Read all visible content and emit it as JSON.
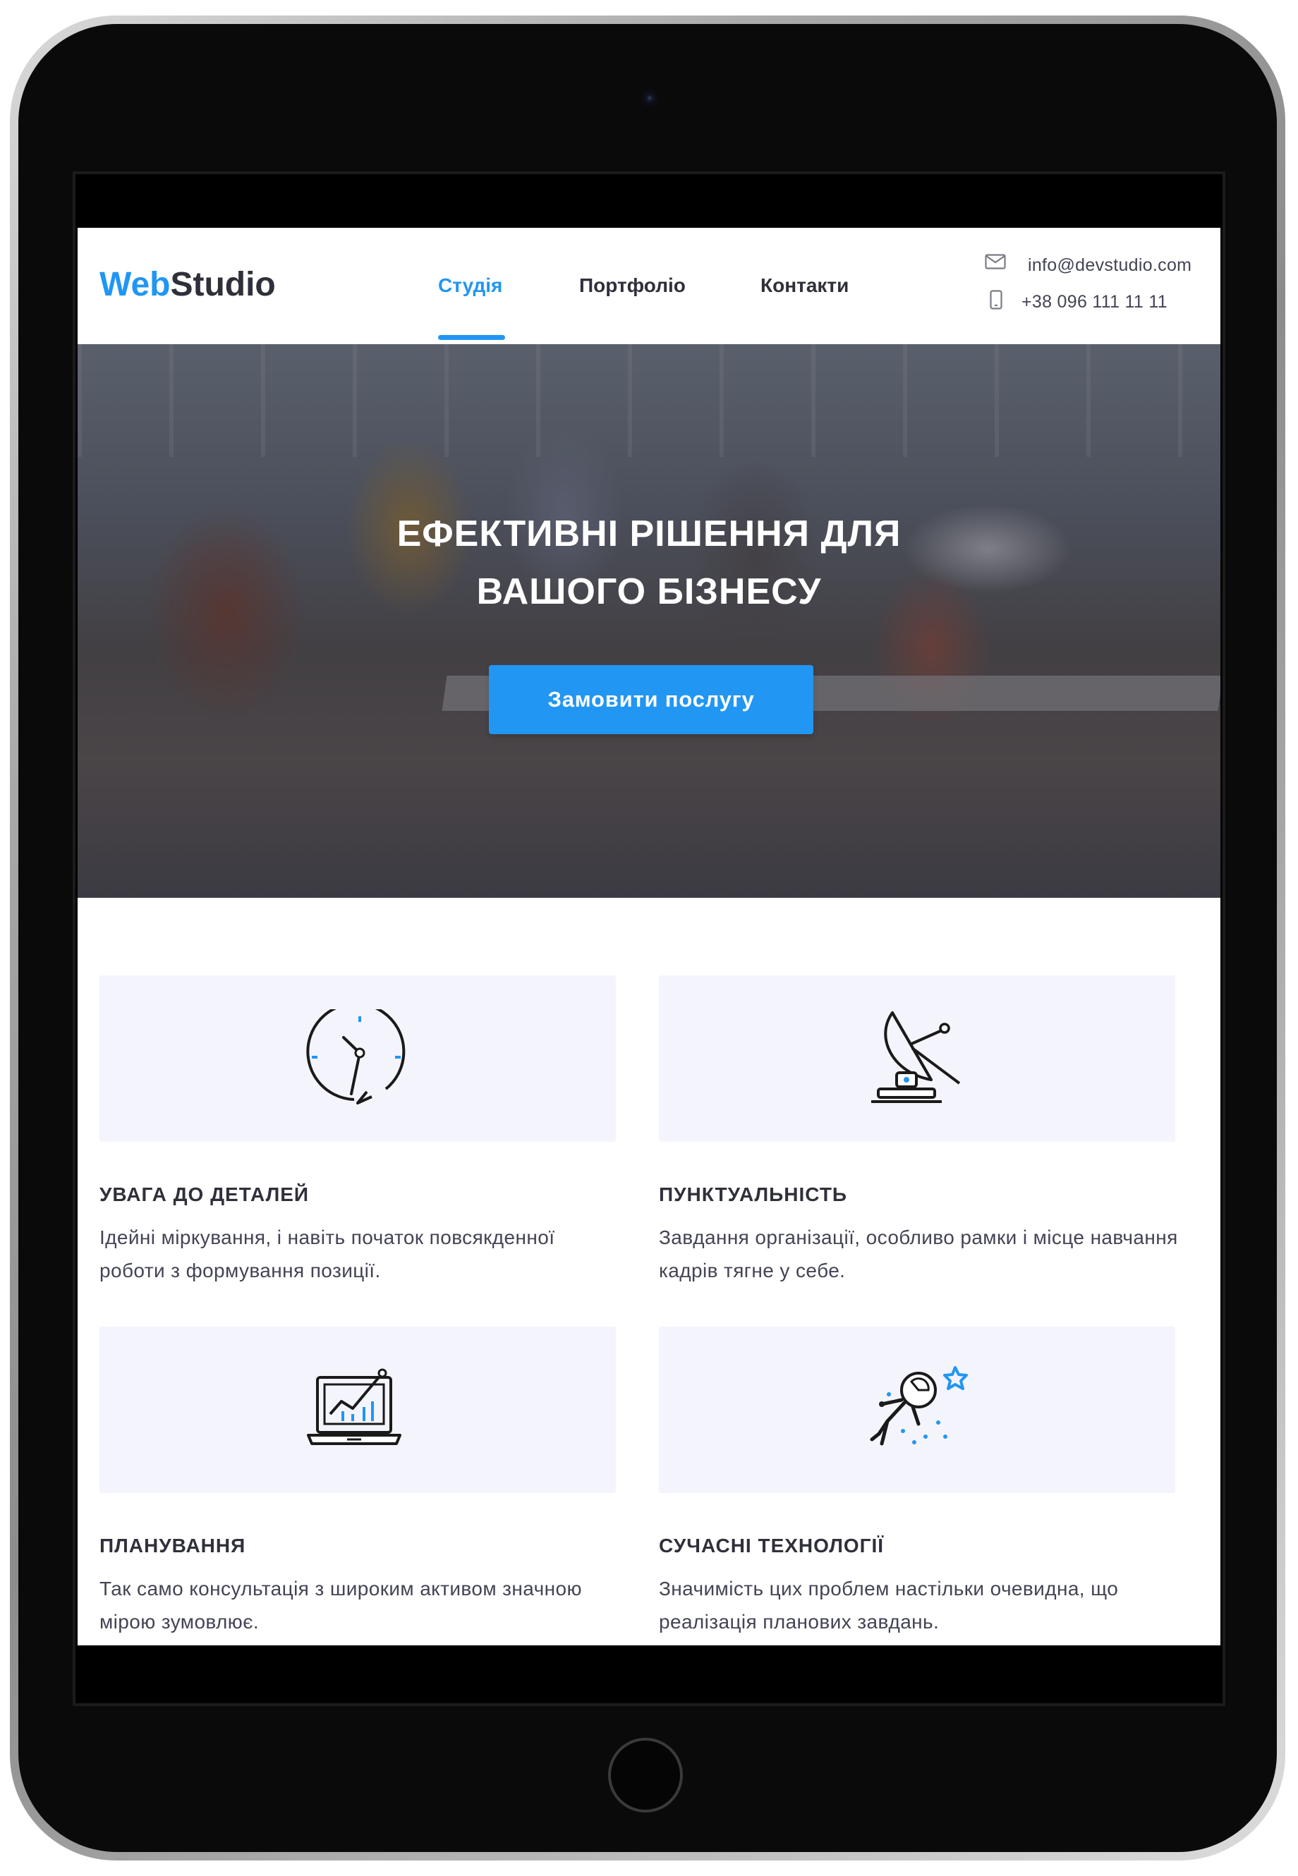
{
  "site": {
    "logo": {
      "part1": "Web",
      "part2": "Studio"
    },
    "nav": [
      {
        "label": "Студія",
        "active": true
      },
      {
        "label": "Портфоліо",
        "active": false
      },
      {
        "label": "Контакти",
        "active": false
      }
    ],
    "contacts": {
      "email": "info@devstudio.com",
      "phone": "+38 096 111 11 11",
      "email_icon": "mail-icon",
      "phone_icon": "smartphone-icon"
    },
    "hero": {
      "title_line1": "Ефективні рішення для",
      "title_line2": "вашого бізнесу",
      "button": "Замовити послугу"
    },
    "features": [
      {
        "icon": "clock-icon",
        "title": "Увага до деталей",
        "text": "Ідейні міркування, і навіть початок повсякденної роботи з формування позиції."
      },
      {
        "icon": "satellite-dish-icon",
        "title": "Пунктуальність",
        "text": "Завдання організації, особливо рамки і місце навчання кадрів тягне у себе."
      },
      {
        "icon": "laptop-chart-icon",
        "title": "Планування",
        "text": "Так само консультація з широким активом значною мірою зумовлює."
      },
      {
        "icon": "astronaut-icon",
        "title": "Сучасні технології",
        "text": "Значимість цих проблем настільки очевидна, що реалізація планових завдань."
      }
    ]
  },
  "colors": {
    "accent": "#2196f3",
    "heading": "#2f303a",
    "text": "#434455",
    "feature_bg": "#f4f4fc",
    "device_frame": "#0a0a0a"
  }
}
